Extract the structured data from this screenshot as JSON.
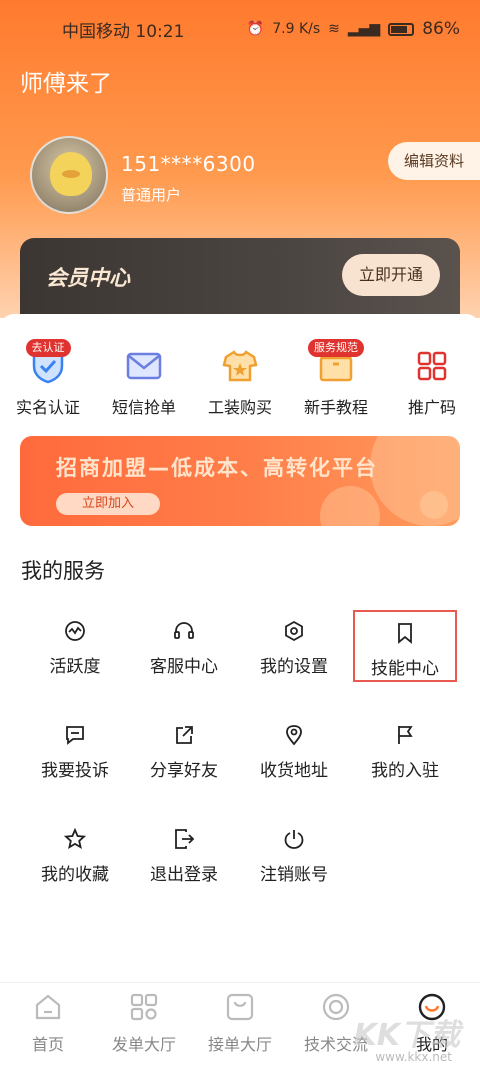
{
  "status": {
    "carrier_time": "中国移动 10:21",
    "speed": "7.9 K/s",
    "battery": "86%"
  },
  "app": {
    "title": "师傅来了"
  },
  "profile": {
    "phone": "151****6300",
    "user_type": "普通用户",
    "edit_label": "编辑资料"
  },
  "vip": {
    "title": "会员中心",
    "button": "立即开通"
  },
  "quick": [
    {
      "label": "实名认证",
      "badge": "去认证",
      "icon": "shield-check-icon"
    },
    {
      "label": "短信抢单",
      "badge": "",
      "icon": "envelope-icon"
    },
    {
      "label": "工装购买",
      "badge": "",
      "icon": "shirt-icon"
    },
    {
      "label": "新手教程",
      "badge": "服务规范",
      "icon": "box-icon"
    },
    {
      "label": "推广码",
      "badge": "",
      "icon": "qr-code-icon"
    }
  ],
  "banner": {
    "text": "招商加盟—低成本、高转化平台",
    "button": "立即加入"
  },
  "services": {
    "title": "我的服务",
    "items": [
      {
        "label": "活跃度",
        "icon": "activity-icon"
      },
      {
        "label": "客服中心",
        "icon": "headset-icon"
      },
      {
        "label": "我的设置",
        "icon": "settings-hex-icon"
      },
      {
        "label": "技能中心",
        "icon": "bookmark-icon"
      },
      {
        "label": "我要投诉",
        "icon": "message-icon"
      },
      {
        "label": "分享好友",
        "icon": "share-icon"
      },
      {
        "label": "收货地址",
        "icon": "location-icon"
      },
      {
        "label": "我的入驻",
        "icon": "flag-icon"
      },
      {
        "label": "我的收藏",
        "icon": "star-icon"
      },
      {
        "label": "退出登录",
        "icon": "logout-icon"
      },
      {
        "label": "注销账号",
        "icon": "power-icon"
      }
    ]
  },
  "tabs": [
    {
      "label": "首页",
      "icon": "home-icon"
    },
    {
      "label": "发单大厅",
      "icon": "grid-icon"
    },
    {
      "label": "接单大厅",
      "icon": "bag-icon"
    },
    {
      "label": "技术交流",
      "icon": "target-icon"
    },
    {
      "label": "我的",
      "icon": "profile-icon",
      "active": true
    }
  ],
  "watermark": {
    "text": "KK下载",
    "url": "www.kkx.net"
  },
  "colors": {
    "accent": "#ff7a2e",
    "highlight_border": "#e85a4f",
    "badge": "#e0332f"
  }
}
